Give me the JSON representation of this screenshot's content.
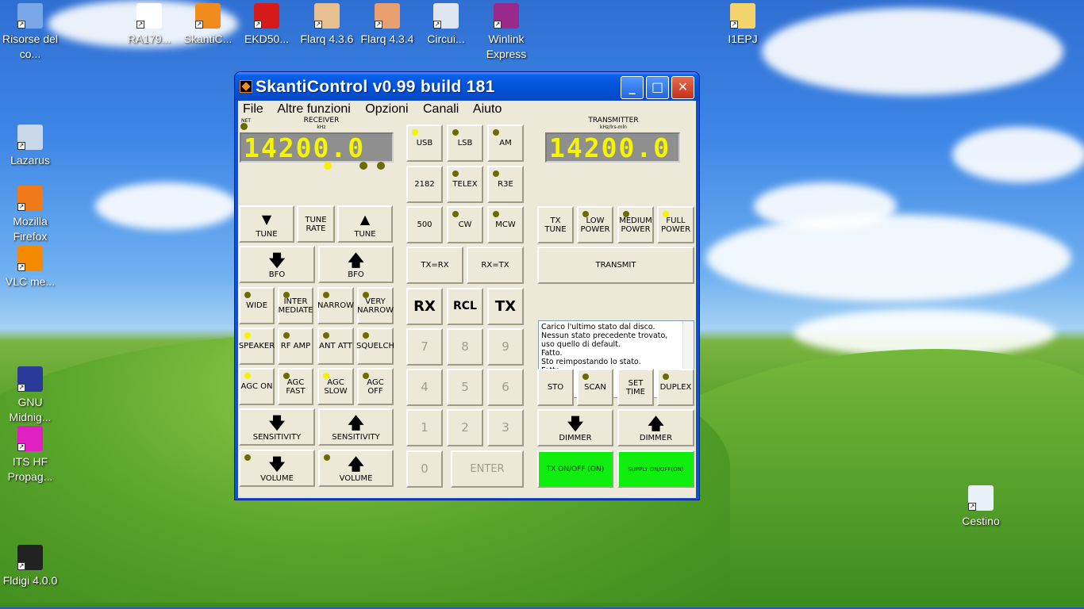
{
  "desktop": {
    "icons": [
      {
        "label": "Risorse del co...",
        "name": "my-computer-icon",
        "color": "#7aa7e8"
      },
      {
        "label": "RA179...",
        "name": "ra179-icon",
        "color": "#ffffff"
      },
      {
        "label": "SkantiC...",
        "name": "skanticontrol-icon",
        "color": "#f28b1d"
      },
      {
        "label": "EKD50...",
        "name": "ekd50-icon",
        "color": "#d61a1a"
      },
      {
        "label": "Flarq 4.3.6",
        "name": "flarq-436-icon",
        "color": "#e8c090"
      },
      {
        "label": "Flarq 4.3.4",
        "name": "flarq-434-icon",
        "color": "#e8a070"
      },
      {
        "label": "Circui...",
        "name": "circuit-icon",
        "color": "#dfe6f2"
      },
      {
        "label": "Winlink Express",
        "name": "winlink-icon",
        "color": "#9a2a8a"
      },
      {
        "label": "I1EPJ",
        "name": "folder-icon",
        "color": "#f3d36b"
      },
      {
        "label": "Lazarus",
        "name": "lazarus-icon",
        "color": "#c8d8e8"
      },
      {
        "label": "Mozilla Firefox",
        "name": "firefox-icon",
        "color": "#f07a1a"
      },
      {
        "label": "VLC me...",
        "name": "vlc-icon",
        "color": "#f58a00"
      },
      {
        "label": "GNU Midnig...",
        "name": "gnu-midnight-icon",
        "color": "#2a3a9a"
      },
      {
        "label": "ITS HF Propag...",
        "name": "its-hf-icon",
        "color": "#e020c0"
      },
      {
        "label": "Fldigi 4.0.0",
        "name": "fldigi-icon",
        "color": "#222222"
      },
      {
        "label": "Cestino",
        "name": "recycle-bin-icon",
        "color": "#e8f0f8"
      }
    ]
  },
  "window": {
    "title": "SkantiControl v0.99 build 181",
    "buttons": {
      "minimize": "_",
      "maximize": "□",
      "close": "✕"
    },
    "menu": [
      "File",
      "Altre funzioni",
      "Opzioni",
      "Canali",
      "Aiuto"
    ]
  },
  "receiver": {
    "net_label": "NET",
    "title": "RECEIVER",
    "unit": "kHz",
    "frequency": "14200.0",
    "tune_down": "TUNE",
    "tune_rate": "TUNE RATE",
    "tune_up": "TUNE",
    "bfo_down": "BFO",
    "bfo_up": "BFO",
    "wide": "WIDE",
    "intermediate": "INTER MEDIATE",
    "narrow": "NARROW",
    "very_narrow": "VERY NARROW",
    "speaker": "SPEAKER",
    "rf_amp": "RF AMP",
    "ant_att": "ANT ATT",
    "squelch": "SQUELCH",
    "agc_on": "AGC ON",
    "agc_fast": "AGC FAST",
    "agc_slow": "AGC SLOW",
    "agc_off": "AGC OFF",
    "sens_down": "SENSITIVITY",
    "sens_up": "SENSITIVITY",
    "vol_down": "VOLUME",
    "vol_up": "VOLUME"
  },
  "modes": {
    "usb": "USB",
    "lsb": "LSB",
    "am": "AM",
    "ch2182": "2182",
    "telex": "TELEX",
    "r3e": "R3E",
    "ch500": "500",
    "cw": "CW",
    "mcw": "MCW",
    "txrx": "TX=RX",
    "rxtx": "RX=TX"
  },
  "keypad": {
    "rx": "RX",
    "rcl": "RCL",
    "tx": "TX",
    "k7": "7",
    "k8": "8",
    "k9": "9",
    "k4": "4",
    "k5": "5",
    "k6": "6",
    "k1": "1",
    "k2": "2",
    "k3": "3",
    "k0": "0",
    "enter": "ENTER"
  },
  "transmitter": {
    "title": "TRANSMITTER",
    "unit": "kHz/lrs-mln",
    "frequency": "14200.0",
    "tx_tune": "TX TUNE",
    "low_power": "LOW POWER",
    "medium_power": "MEDIUM POWER",
    "full_power": "FULL POWER",
    "transmit": "TRANSMIT",
    "sto": "STO",
    "scan": "SCAN",
    "set_time": "SET TIME",
    "duplex": "DUPLEX",
    "dimmer_down": "DIMMER",
    "dimmer_up": "DIMMER",
    "tx_onoff": "TX ON/OFF (ON)",
    "supply_onoff": "SUPPLY ON/OFF(ON)"
  },
  "log": "Carico l'ultimo stato dal disco.\nNessun stato precedente trovato,\nuso quello di default.\nFatto.\nSto reimpostando lo stato.\nFatto.\nPronto!"
}
